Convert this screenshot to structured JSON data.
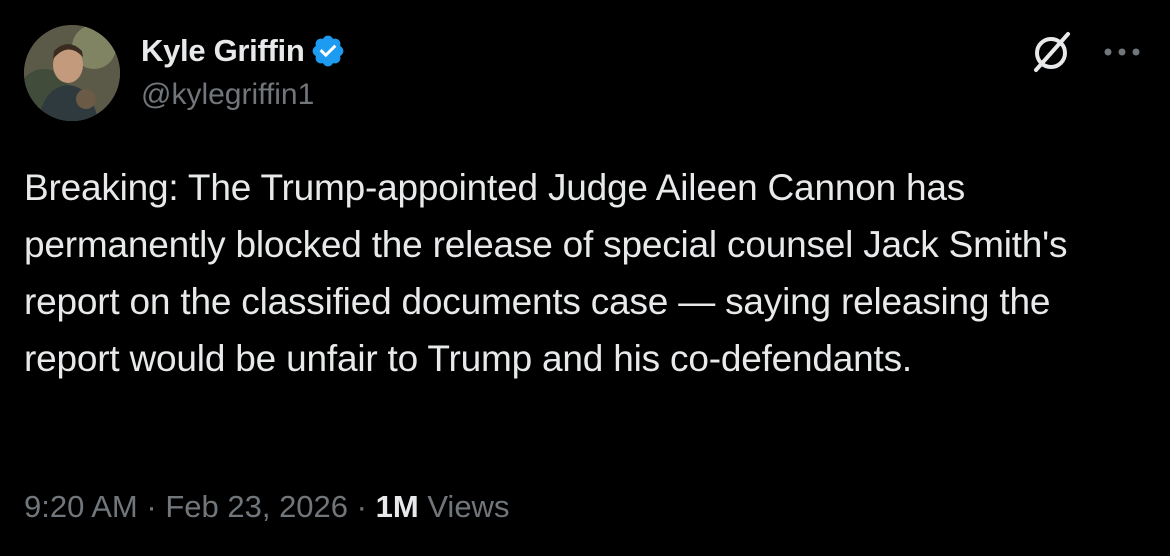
{
  "author": {
    "display_name": "Kyle Griffin",
    "handle": "@kylegriffin1",
    "verified": true,
    "verified_color": "#1d9bf0",
    "avatar_icon": "profile-photo"
  },
  "actions": {
    "grok_icon": "grok-icon",
    "more_icon": "more-options-icon"
  },
  "tweet": {
    "text": "Breaking: The Trump-appointed Judge Aileen Cannon has permanently blocked the release of special counsel Jack Smith's report on the classified documents case — saying releasing the report would be unfair to Trump and his co-defendants."
  },
  "meta": {
    "time": "9:20 AM",
    "separator": "·",
    "date": "Feb 23, 2026",
    "views_count": "1M",
    "views_label": "Views"
  },
  "colors": {
    "background": "#000000",
    "primary_text": "#e7e9ea",
    "secondary_text": "#71767b"
  }
}
